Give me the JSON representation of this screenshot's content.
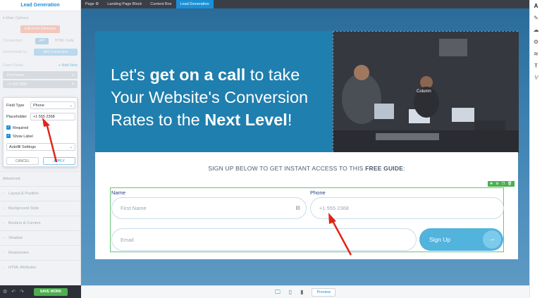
{
  "left_panel": {
    "title": "Lead Generation",
    "main_options": "Main Options",
    "edit_form_elements": "Edit Form Elements",
    "connection_label": "Connection",
    "connection_api": "API",
    "connection_html": "HTML Code",
    "send_leads_label": "Send leads to",
    "add_connection": "Add Connection",
    "form_fields_label": "Form Fields",
    "add_new": "+ Add New",
    "fields": [
      "First Name",
      "+1 555 2368"
    ],
    "popup": {
      "field_type_label": "Field Type",
      "field_type_value": "Phone",
      "placeholder_label": "Placeholder",
      "placeholder_value": "+1 555 2368",
      "required_label": "Required",
      "show_label_label": "Show Label",
      "autofill_label": "Autofill Settings",
      "cancel": "CANCEL",
      "apply": "APPLY"
    },
    "sections": [
      "Advanced",
      "Layout & Position",
      "Background Style",
      "Borders & Corners",
      "Shadow",
      "Responsive",
      "HTML Attributes"
    ],
    "save_work": "SAVE WORK"
  },
  "breadcrumb": [
    "Page",
    "Landing Page Block",
    "Content Box",
    "Lead Generation"
  ],
  "hero": {
    "line1_pre": "Let's ",
    "line1_bold": "get on a call",
    "line1_post": " to take",
    "line2": "Your Website's Conversion",
    "line3_pre": "Rates to the ",
    "line3_bold": "Next Level",
    "line3_post": "!",
    "photo_label": "Column"
  },
  "form": {
    "guide_pre": "SIGN UP BELOW TO GET INSTANT ACCESS TO THIS ",
    "guide_bold": "FREE GUIDE",
    "guide_post": ":",
    "name_label": "Name",
    "name_placeholder": "First Name",
    "phone_label": "Phone",
    "phone_placeholder": "+1 555 2368",
    "email_placeholder": "Email",
    "signup_label": "Sign Up"
  },
  "bottom_bar": {
    "preview": "Preview"
  },
  "colors": {
    "accent": "#1a8fd6",
    "save": "#4caf50",
    "hero": "#1f7fae",
    "signup": "#52b3dc",
    "annotation": "#e2231a"
  }
}
